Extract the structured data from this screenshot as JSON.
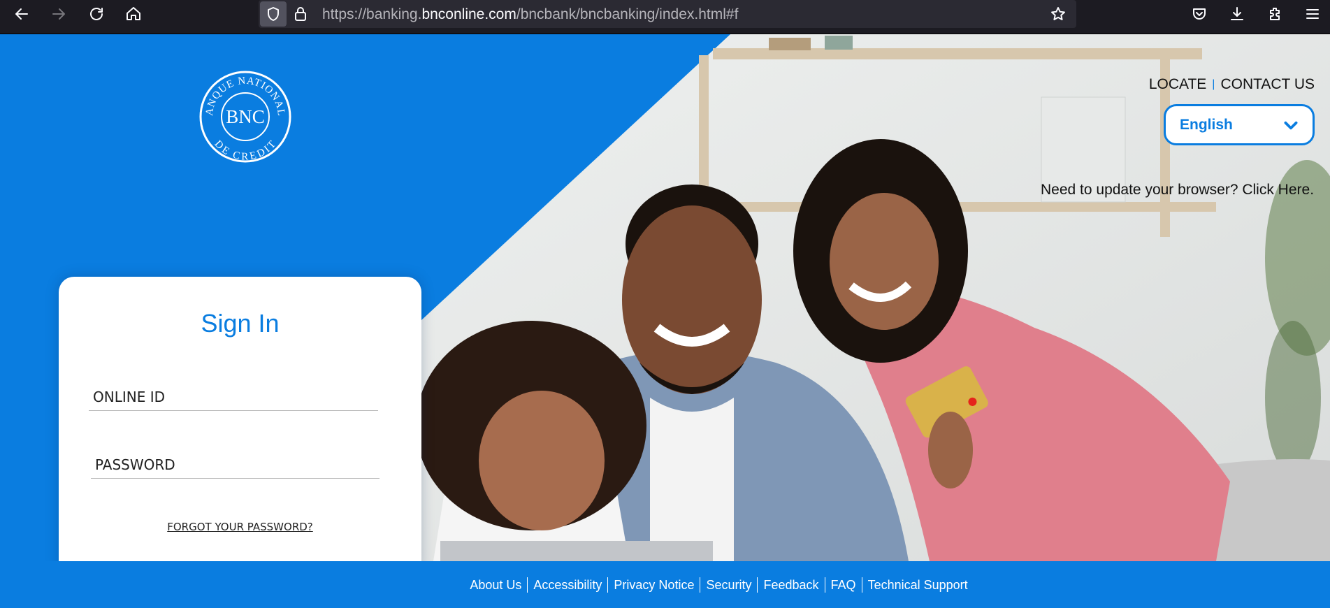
{
  "browser": {
    "url_prefix": "https://banking.",
    "url_domain": "bnconline.com",
    "url_path": "/bncbank/bncbanking/index.html#f",
    "icons": [
      "back-icon",
      "forward-icon",
      "reload-icon",
      "home-icon",
      "shield-icon",
      "lock-icon",
      "star-icon",
      "pocket-icon",
      "download-icon",
      "extensions-icon",
      "menu-icon"
    ]
  },
  "header": {
    "locate": "LOCATE",
    "separator": "|",
    "contact": "CONTACT US",
    "language": "English",
    "update_browser": "Need to update your browser? Click Here."
  },
  "logo": {
    "top_text": "BANQUE NATIONALE",
    "center_text": "BNC",
    "bottom_text": "DE CREDIT"
  },
  "signin": {
    "title": "Sign In",
    "online_id_label": "ONLINE ID",
    "password_label": "PASSWORD",
    "forgot": "FORGOT YOUR PASSWORD?"
  },
  "footer": {
    "links": [
      "About Us",
      "Accessibility",
      "Privacy Notice",
      "Security",
      "Feedback",
      "FAQ",
      "Technical Support"
    ]
  },
  "colors": {
    "brand_blue": "#0a7de0",
    "chrome_bg": "#1c1b22",
    "urlbar_bg": "#2b2a33"
  }
}
